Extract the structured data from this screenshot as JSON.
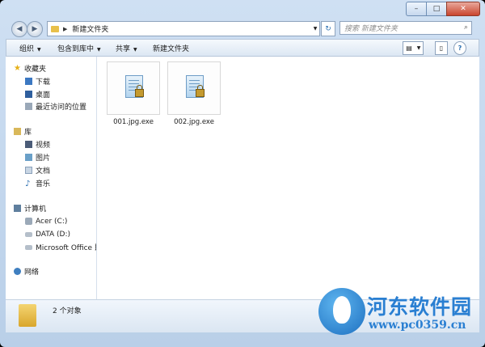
{
  "window": {
    "buttons": {
      "minimize": "–",
      "maximize": "□",
      "close": "✕"
    }
  },
  "addressbar": {
    "back_icon": "back-arrow-icon",
    "forward_icon": "forward-arrow-icon",
    "path": "新建文件夹",
    "separator": "▶",
    "search_placeholder": "搜索 新建文件夹"
  },
  "toolbar": {
    "organize": "组织",
    "include_in_library": "包含到库中",
    "share": "共享",
    "new_folder": "新建文件夹"
  },
  "nav": {
    "favorites": {
      "label": "收藏夹",
      "items": [
        {
          "label": "下载"
        },
        {
          "label": "桌面"
        },
        {
          "label": "最近访问的位置"
        }
      ]
    },
    "libraries": {
      "label": "库",
      "items": [
        {
          "label": "视频"
        },
        {
          "label": "图片"
        },
        {
          "label": "文档"
        },
        {
          "label": "音乐"
        }
      ]
    },
    "computer": {
      "label": "计算机",
      "items": [
        {
          "label": "Acer (C:)"
        },
        {
          "label": "DATA (D:)"
        },
        {
          "label": "Microsoft Office 即"
        }
      ]
    },
    "network": {
      "label": "网络"
    }
  },
  "files": [
    {
      "name": "001.jpg.exe"
    },
    {
      "name": "002.jpg.exe"
    }
  ],
  "status": {
    "count_text": "2 个对象"
  },
  "watermark": {
    "title": "河东软件园",
    "url": "www.pc0359.cn"
  },
  "colors": {
    "accent": "#2a7fd2",
    "folder": "#e8c04a",
    "close": "#c9452e"
  }
}
